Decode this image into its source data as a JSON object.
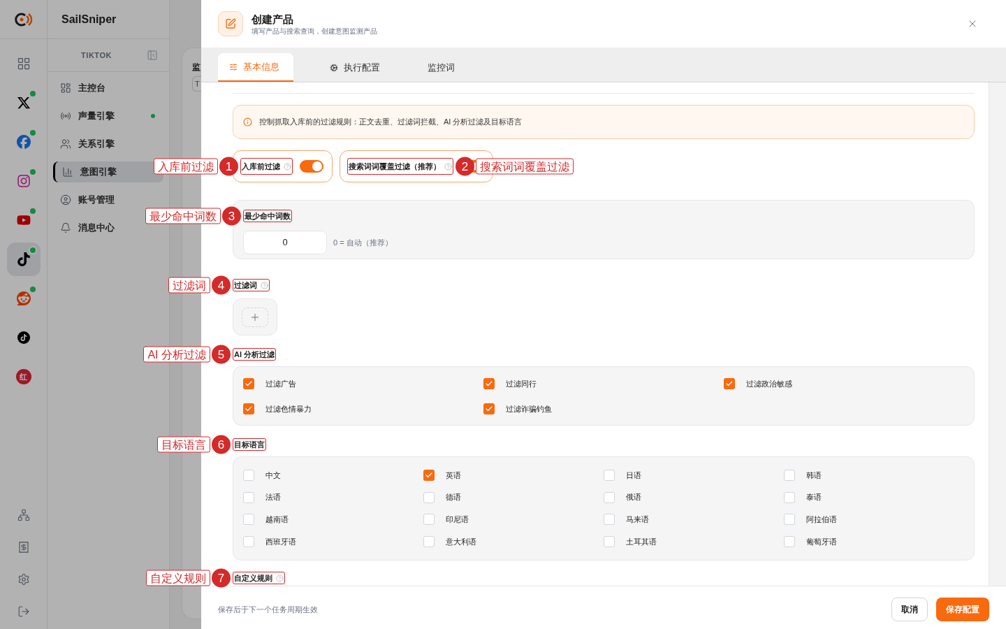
{
  "rail": {
    "items": [
      {
        "kind": "grid",
        "online": false,
        "selected": false
      },
      {
        "kind": "x",
        "online": true,
        "selected": false
      },
      {
        "kind": "facebook",
        "online": true,
        "selected": false
      },
      {
        "kind": "instagram",
        "online": true,
        "selected": false
      },
      {
        "kind": "youtube",
        "online": true,
        "selected": false
      },
      {
        "kind": "tiktok",
        "online": true,
        "selected": true
      },
      {
        "kind": "reddit",
        "online": true,
        "selected": false
      },
      {
        "kind": "tiktok-round",
        "online": false,
        "selected": false
      },
      {
        "kind": "xiaohongshu",
        "text": "红",
        "online": false,
        "selected": false
      }
    ],
    "bottom_items": [
      {
        "kind": "network"
      },
      {
        "kind": "bill"
      },
      {
        "kind": "settings"
      },
      {
        "kind": "logout"
      }
    ]
  },
  "sidebar": {
    "brand": "SailSniper",
    "platform": "TIKTOK",
    "items": [
      {
        "label": "主控台",
        "online": false,
        "selected": false
      },
      {
        "label": "声量引擎",
        "online": true,
        "selected": false
      },
      {
        "label": "关系引擎",
        "online": false,
        "selected": false
      },
      {
        "label": "意图引擎",
        "online": false,
        "selected": true
      },
      {
        "label": "账号管理",
        "online": false,
        "selected": false
      },
      {
        "label": "消息中心",
        "online": false,
        "selected": false
      }
    ]
  },
  "background": {
    "heading": "监",
    "field": "T"
  },
  "drawer": {
    "title": "创建产品",
    "subtitle": "填写产品与搜索查询，创建意图监测产品",
    "tabs": [
      {
        "label": "基本信息",
        "selected": true
      },
      {
        "label": "执行配置",
        "selected": false
      },
      {
        "label": "监控词",
        "selected": false
      }
    ],
    "notice": "控制抓取入库前的过滤规则：正文去重、过滤词拦截、AI 分析过滤及目标语言",
    "toggles": [
      {
        "label": "入库前过滤",
        "help": true,
        "on": true,
        "annotation": {
          "number": "1",
          "label": "入库前过滤"
        }
      },
      {
        "label": "搜索词词覆盖过滤（推荐）",
        "help": true,
        "on": true,
        "annotation": {
          "number": "2",
          "label": "搜索词词覆盖过滤"
        }
      }
    ],
    "min_hits": {
      "label": "最少命中词数",
      "value": "0",
      "hint": "0 = 自动（推荐）",
      "annotation": {
        "number": "3",
        "label": "最少命中词数"
      }
    },
    "filter_words": {
      "label": "过滤词",
      "help": true,
      "annotation": {
        "number": "4",
        "label": "过滤词"
      }
    },
    "ai_filter": {
      "label": "AI 分析过滤",
      "annotation": {
        "number": "5",
        "label": "AI 分析过滤"
      },
      "options": [
        {
          "label": "过滤广告",
          "checked": true
        },
        {
          "label": "过滤同行",
          "checked": true
        },
        {
          "label": "过滤政治敏感",
          "checked": true
        },
        {
          "label": "过滤色情暴力",
          "checked": true
        },
        {
          "label": "过滤诈骗钓鱼",
          "checked": true
        }
      ]
    },
    "languages": {
      "label": "目标语言",
      "annotation": {
        "number": "6",
        "label": "目标语言"
      },
      "options": [
        {
          "label": "中文",
          "checked": false
        },
        {
          "label": "英语",
          "checked": true
        },
        {
          "label": "日语",
          "checked": false
        },
        {
          "label": "韩语",
          "checked": false
        },
        {
          "label": "法语",
          "checked": false
        },
        {
          "label": "德语",
          "checked": false
        },
        {
          "label": "俄语",
          "checked": false
        },
        {
          "label": "泰语",
          "checked": false
        },
        {
          "label": "越南语",
          "checked": false
        },
        {
          "label": "印尼语",
          "checked": false
        },
        {
          "label": "马来语",
          "checked": false
        },
        {
          "label": "阿拉伯语",
          "checked": false
        },
        {
          "label": "西班牙语",
          "checked": false
        },
        {
          "label": "意大利语",
          "checked": false
        },
        {
          "label": "土耳其语",
          "checked": false
        },
        {
          "label": "葡萄牙语",
          "checked": false
        }
      ]
    },
    "custom_rules": {
      "label": "自定义规则",
      "help": true,
      "annotation": {
        "number": "7",
        "label": "自定义规则"
      }
    },
    "footer": {
      "note": "保存后于下一个任务周期生效",
      "buttons": [
        {
          "label": "取消",
          "kind": "secondary"
        },
        {
          "label": "保存配置",
          "kind": "primary"
        }
      ]
    }
  }
}
